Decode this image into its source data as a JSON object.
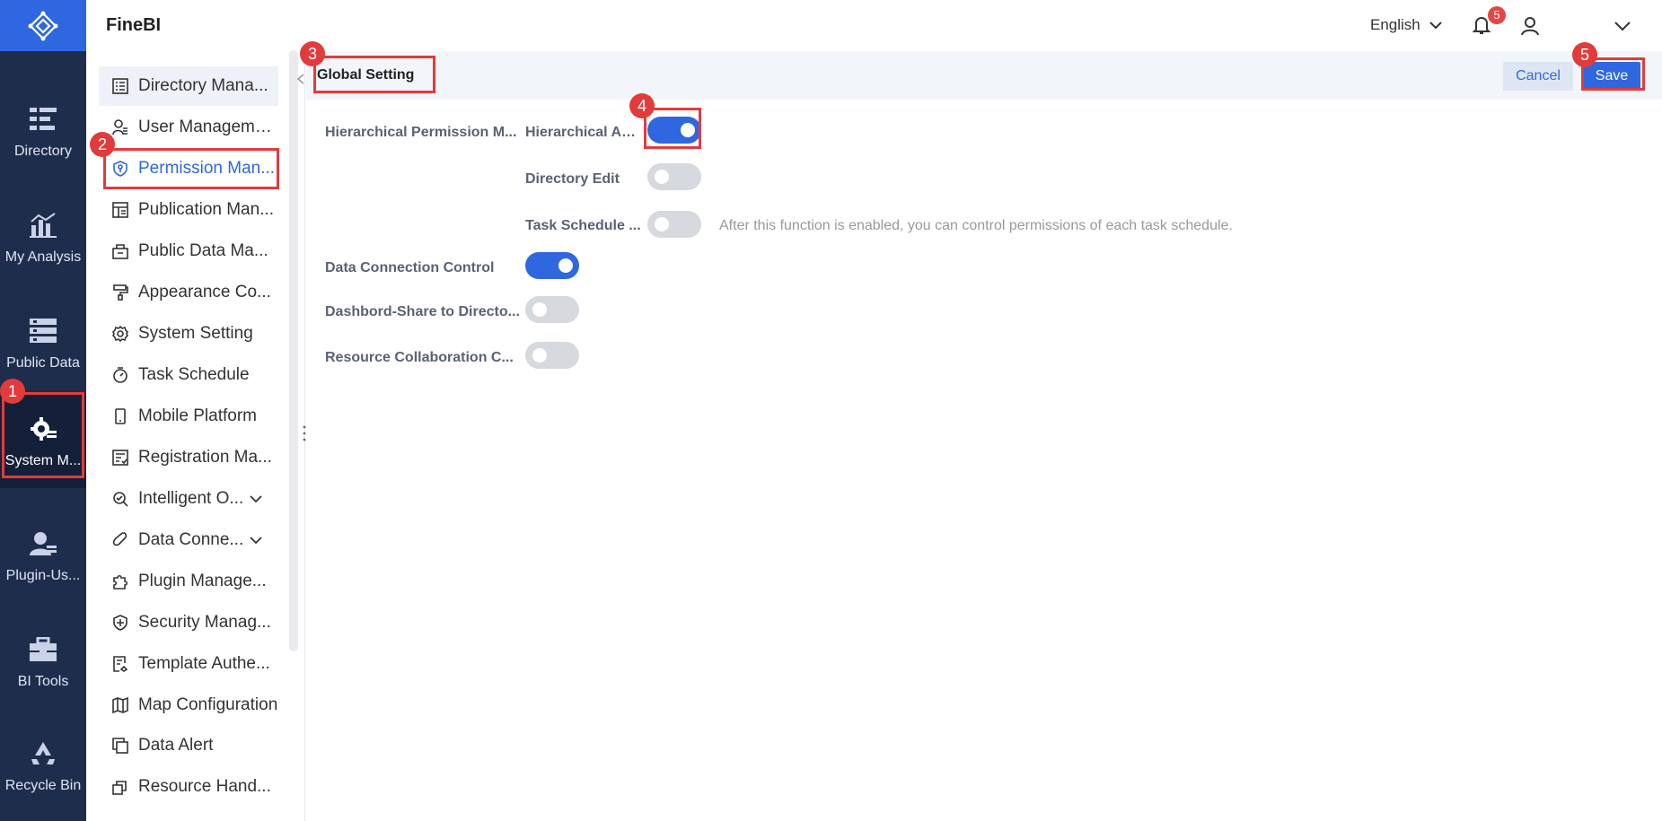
{
  "app": {
    "brand": "FineBI"
  },
  "header": {
    "language": "English",
    "notification_count": "5"
  },
  "rail": {
    "items": [
      {
        "label": "Directory",
        "icon": "directory-icon"
      },
      {
        "label": "My Analysis",
        "icon": "analysis-icon"
      },
      {
        "label": "Public Data",
        "icon": "public-data-icon"
      },
      {
        "label": "System M...",
        "icon": "system-management-icon"
      },
      {
        "label": "Plugin-Us...",
        "icon": "plugin-user-icon"
      },
      {
        "label": "BI Tools",
        "icon": "toolbox-icon"
      },
      {
        "label": "Recycle Bin",
        "icon": "recycle-bin-icon"
      }
    ]
  },
  "sidebar": {
    "items": [
      {
        "label": "Directory Mana...",
        "icon": "list-icon"
      },
      {
        "label": "User Management",
        "icon": "user-icon"
      },
      {
        "label": "Permission Man...",
        "icon": "shield-key-icon"
      },
      {
        "label": "Publication Man...",
        "icon": "publication-icon"
      },
      {
        "label": "Public Data Ma...",
        "icon": "database-icon"
      },
      {
        "label": "Appearance Co...",
        "icon": "paint-roller-icon"
      },
      {
        "label": "System Setting",
        "icon": "gear-icon"
      },
      {
        "label": "Task Schedule",
        "icon": "stopwatch-icon"
      },
      {
        "label": "Mobile Platform",
        "icon": "mobile-icon"
      },
      {
        "label": "Registration Ma...",
        "icon": "registration-icon"
      },
      {
        "label": "Intelligent O...",
        "icon": "intelligent-ops-icon"
      },
      {
        "label": "Data Conne...",
        "icon": "paperclip-icon"
      },
      {
        "label": "Plugin Manage...",
        "icon": "puzzle-icon"
      },
      {
        "label": "Security Manag...",
        "icon": "shield-icon"
      },
      {
        "label": "Template Authe...",
        "icon": "template-icon"
      },
      {
        "label": "Map Configuration",
        "icon": "map-icon"
      },
      {
        "label": "Data Alert",
        "icon": "alert-icon"
      },
      {
        "label": "Resource Hand...",
        "icon": "resource-icon"
      }
    ]
  },
  "main": {
    "section_title": "Global Setting",
    "cancel_label": "Cancel",
    "save_label": "Save",
    "settings": {
      "hierarchical_group_label": "Hierarchical Permission M...",
      "hierarchical_auth_label": "Hierarchical Au...",
      "hierarchical_auth_on": true,
      "directory_edit_label": "Directory Edit",
      "directory_edit_on": false,
      "task_schedule_label": "Task Schedule ...",
      "task_schedule_on": false,
      "task_schedule_hint": "After this function is enabled, you can control permissions of each task schedule.",
      "data_connection_label": "Data Connection Control",
      "data_connection_on": true,
      "dashboard_share_label": "Dashbord-Share to Directo...",
      "dashboard_share_on": false,
      "resource_collab_label": "Resource Collaboration C...",
      "resource_collab_on": false
    }
  },
  "annotations": [
    "1",
    "2",
    "3",
    "4",
    "5"
  ],
  "colors": {
    "accent": "#2e67e0",
    "rail": "#1f2d4d",
    "annotation": "#e23b3b"
  }
}
